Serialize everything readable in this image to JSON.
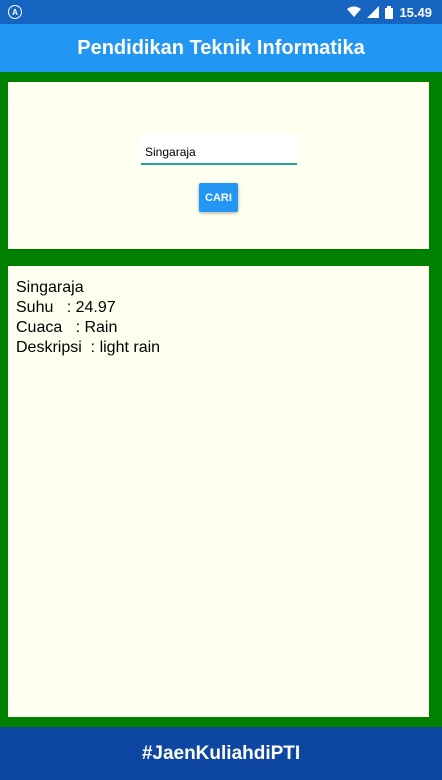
{
  "status_bar": {
    "app_icon_letter": "A",
    "time": "15.49"
  },
  "app_bar": {
    "title": "Pendidikan Teknik Informatika"
  },
  "search": {
    "input_value": "Singaraja",
    "button_label": "CARI"
  },
  "result": {
    "city": "Singaraja",
    "suhu": "Suhu   : 24.97",
    "cuaca": "Cuaca   : Rain",
    "deskripsi": "Deskripsi  : light rain"
  },
  "footer": {
    "hashtag": "#JaenKuliahdiPTI"
  },
  "colors": {
    "status_bar": "#1565c0",
    "app_bar": "#2196f3",
    "frame": "#008000",
    "panel": "#fffff0",
    "footer": "#0d47a1",
    "button": "#2196f3"
  },
  "icons": [
    "app-notification-icon",
    "wifi-icon",
    "signal-icon",
    "battery-icon"
  ]
}
